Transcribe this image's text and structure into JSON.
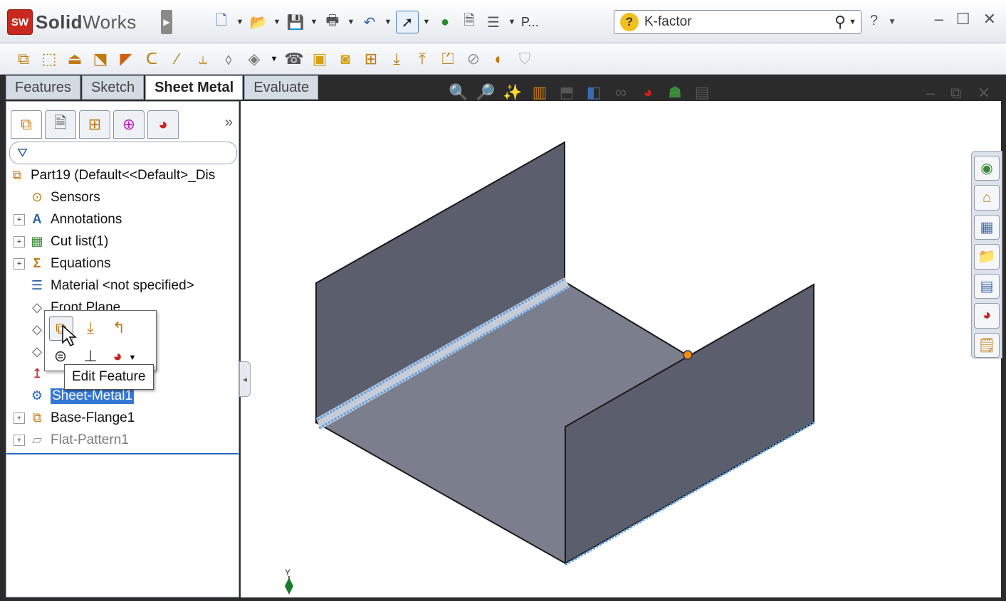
{
  "app": {
    "brand_bold": "Solid",
    "brand_light": "Works",
    "logo_text": "SW"
  },
  "toolbar": {
    "truncated_label": "P...",
    "help": "?"
  },
  "search": {
    "value": "K-factor"
  },
  "command_tabs": [
    "Features",
    "Sketch",
    "Sheet Metal",
    "Evaluate"
  ],
  "active_tab": "Sheet Metal",
  "tree": {
    "root": "Part19  (Default<<Default>_Dis",
    "items": [
      {
        "label": "Sensors",
        "expandable": false
      },
      {
        "label": "Annotations",
        "expandable": true
      },
      {
        "label": "Cut list(1)",
        "expandable": true
      },
      {
        "label": "Equations",
        "expandable": true
      },
      {
        "label": "Material <not specified>",
        "expandable": false
      },
      {
        "label": "Front Plane",
        "expandable": false
      },
      {
        "label": "Sheet-Metal1",
        "expandable": false,
        "selected": true
      },
      {
        "label": "Base-Flange1",
        "expandable": true
      },
      {
        "label": "Flat-Pattern1",
        "expandable": true,
        "suppressed": true
      }
    ]
  },
  "tooltip": {
    "text": "Edit Feature"
  },
  "triad": {
    "label": "Y"
  },
  "colors": {
    "selection": "#3478d6",
    "part_face": "#5c5f6e",
    "bend_highlight": "#5aa0e8",
    "vertex": "#f08a10"
  }
}
